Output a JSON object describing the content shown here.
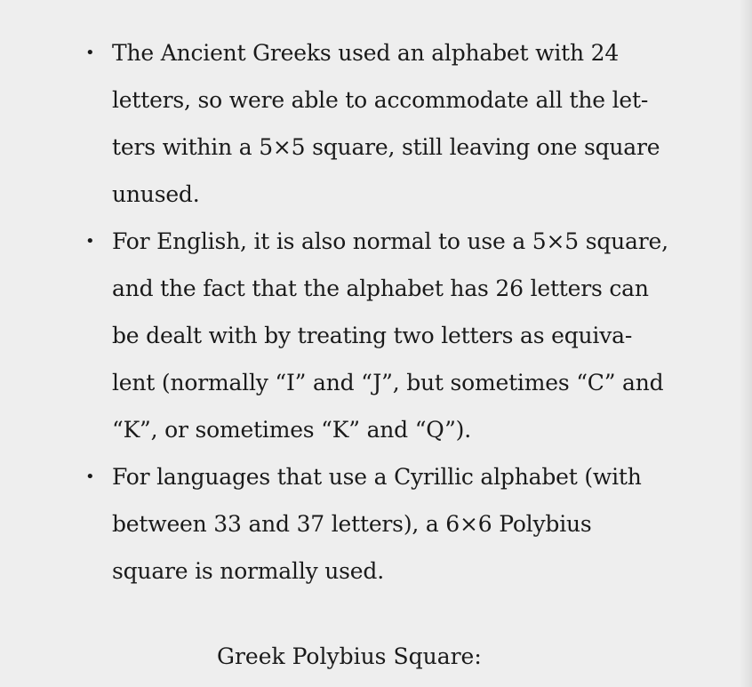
{
  "bullets": [
    {
      "lines": [
        "The Ancient Greeks used an alphabet with 24",
        "letters, so were able to accommodate all the let-",
        "ters within a 5×5 square, still leaving one square",
        "unused."
      ]
    },
    {
      "lines": [
        "For English, it is also normal to use a 5×5 square,",
        "and the fact that the alphabet has 26 letters can",
        "be dealt with by treating two letters as equiva-",
        "lent (normally “I” and “J”, but sometimes “C” and",
        "“K”, or sometimes “K” and “Q”)."
      ]
    },
    {
      "lines": [
        "For languages that use a Cyrillic alphabet (with",
        "between 33 and 37 letters), a 6×6 Polybius",
        "square is normally used."
      ]
    }
  ],
  "caption": "Greek Polybius Square:"
}
